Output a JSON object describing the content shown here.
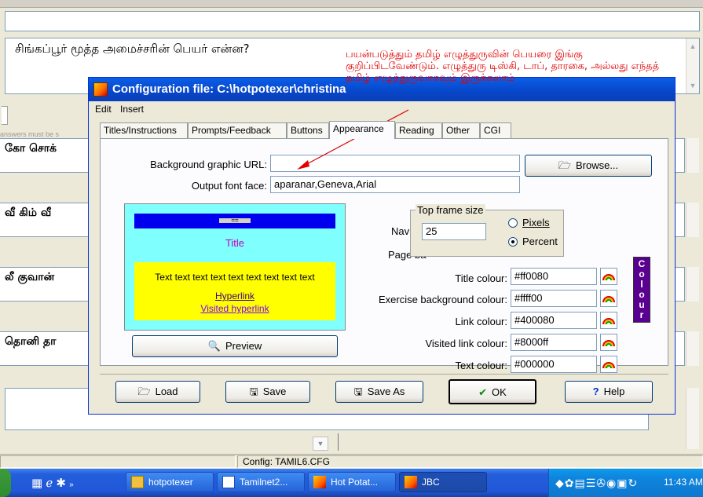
{
  "background": {
    "question_text": "சிங்கப்பூர் மூத்த அமைச்சரின் பெயர் என்ன?",
    "hint_text": "answers must be s",
    "answers": [
      "கோ சொக்",
      "வீ கிம் வீ",
      "லீ குவான்",
      "தொனி தா"
    ],
    "status_config": "Config: TAMIL6.CFG"
  },
  "dialog": {
    "title": "Configuration file: C:\\hotpotexer\\christina",
    "menu": [
      "Edit",
      "Insert"
    ],
    "tabs": [
      "Titles/Instructions",
      "Prompts/Feedback",
      "Buttons",
      "Appearance",
      "Reading",
      "Other",
      "CGI"
    ],
    "active_tab": "Appearance",
    "bg_graphic_label": "Background graphic URL:",
    "bg_graphic_value": "",
    "output_font_label": "Output font face:",
    "output_font_value": "aparanar,Geneva,Arial",
    "browse_label": "Browse...",
    "preview": {
      "bar_button": "==",
      "title": "Title",
      "body": "Text text text text text text text text text",
      "hyperlink": "Hyperlink",
      "visited_hyperlink": "Visited hyperlink",
      "preview_button": "Preview"
    },
    "navig_label": "Navig",
    "page_bg_label": "Page ba",
    "frame_group": {
      "title": "Top frame size",
      "value": "25",
      "pixels_label": "Pixels",
      "percent_label": "Percent",
      "selected": "Percent"
    },
    "colour_fields": [
      {
        "label": "Title colour:",
        "value": "#ff0080"
      },
      {
        "label": "Exercise background colour:",
        "value": "#ffff00"
      },
      {
        "label": "Link colour:",
        "value": "#400080"
      },
      {
        "label": "Visited link colour:",
        "value": "#8000ff"
      },
      {
        "label": "Text colour:",
        "value": "#000000"
      }
    ],
    "colours_badge": "Colours",
    "footer_buttons": {
      "load": "Load",
      "save": "Save",
      "save_as": "Save As",
      "ok": "OK",
      "help": "Help"
    }
  },
  "annotation": "பயன்படுத்தும் தமிழ் எழுத்துருவின் பெயரை இங்கு குறிப்பிடவேண்டும். எழுத்துரு டிஸ்கி, டாப், தாரகை, அல்லது எந்தத் தமிழ் எழுத்துருவாகவும் இருக்கலாம்",
  "taskbar": {
    "tasks": [
      "hotpotexer",
      "Tamilnet2...",
      "Hot Potat...",
      "JBC"
    ],
    "clock": "11:43 AM"
  },
  "colors": {
    "preview_bg": "#80ffff",
    "preview_nav": "#0000ee",
    "preview_exercise_bg": "#ffff00",
    "link": "#400080",
    "visited": "#8000ff",
    "annotation": "#e00000"
  }
}
